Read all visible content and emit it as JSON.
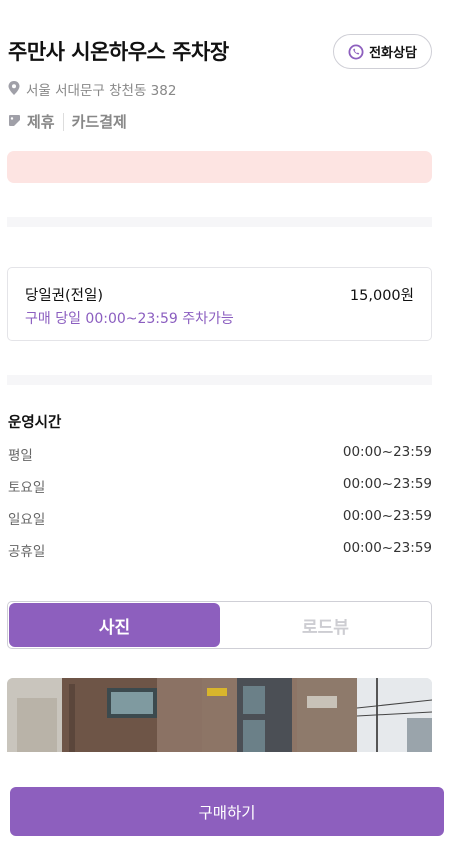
{
  "header": {
    "title": "주만사 시온하우스 주차장",
    "call_button": "전화상담"
  },
  "address": "서울 서대문구 창천동 382",
  "tags": [
    "제휴",
    "카드결제"
  ],
  "ticket": {
    "name": "당일권(전일)",
    "price": "15,000원",
    "description": "구매 당일 00:00~23:59 주차가능"
  },
  "hours": {
    "title": "운영시간",
    "rows": [
      {
        "day": "평일",
        "time": "00:00~23:59"
      },
      {
        "day": "토요일",
        "time": "00:00~23:59"
      },
      {
        "day": "일요일",
        "time": "00:00~23:59"
      },
      {
        "day": "공휴일",
        "time": "00:00~23:59"
      }
    ]
  },
  "segment": {
    "active": "사진",
    "inactive": "로드뷰"
  },
  "buy_button": "구매하기",
  "colors": {
    "accent": "#8d5fbe",
    "notice_bg": "#fde4e2",
    "muted_text": "#888888"
  },
  "icons": {
    "call": "phone-chat-icon",
    "location": "location-pin-icon",
    "tag": "tag-icon"
  }
}
